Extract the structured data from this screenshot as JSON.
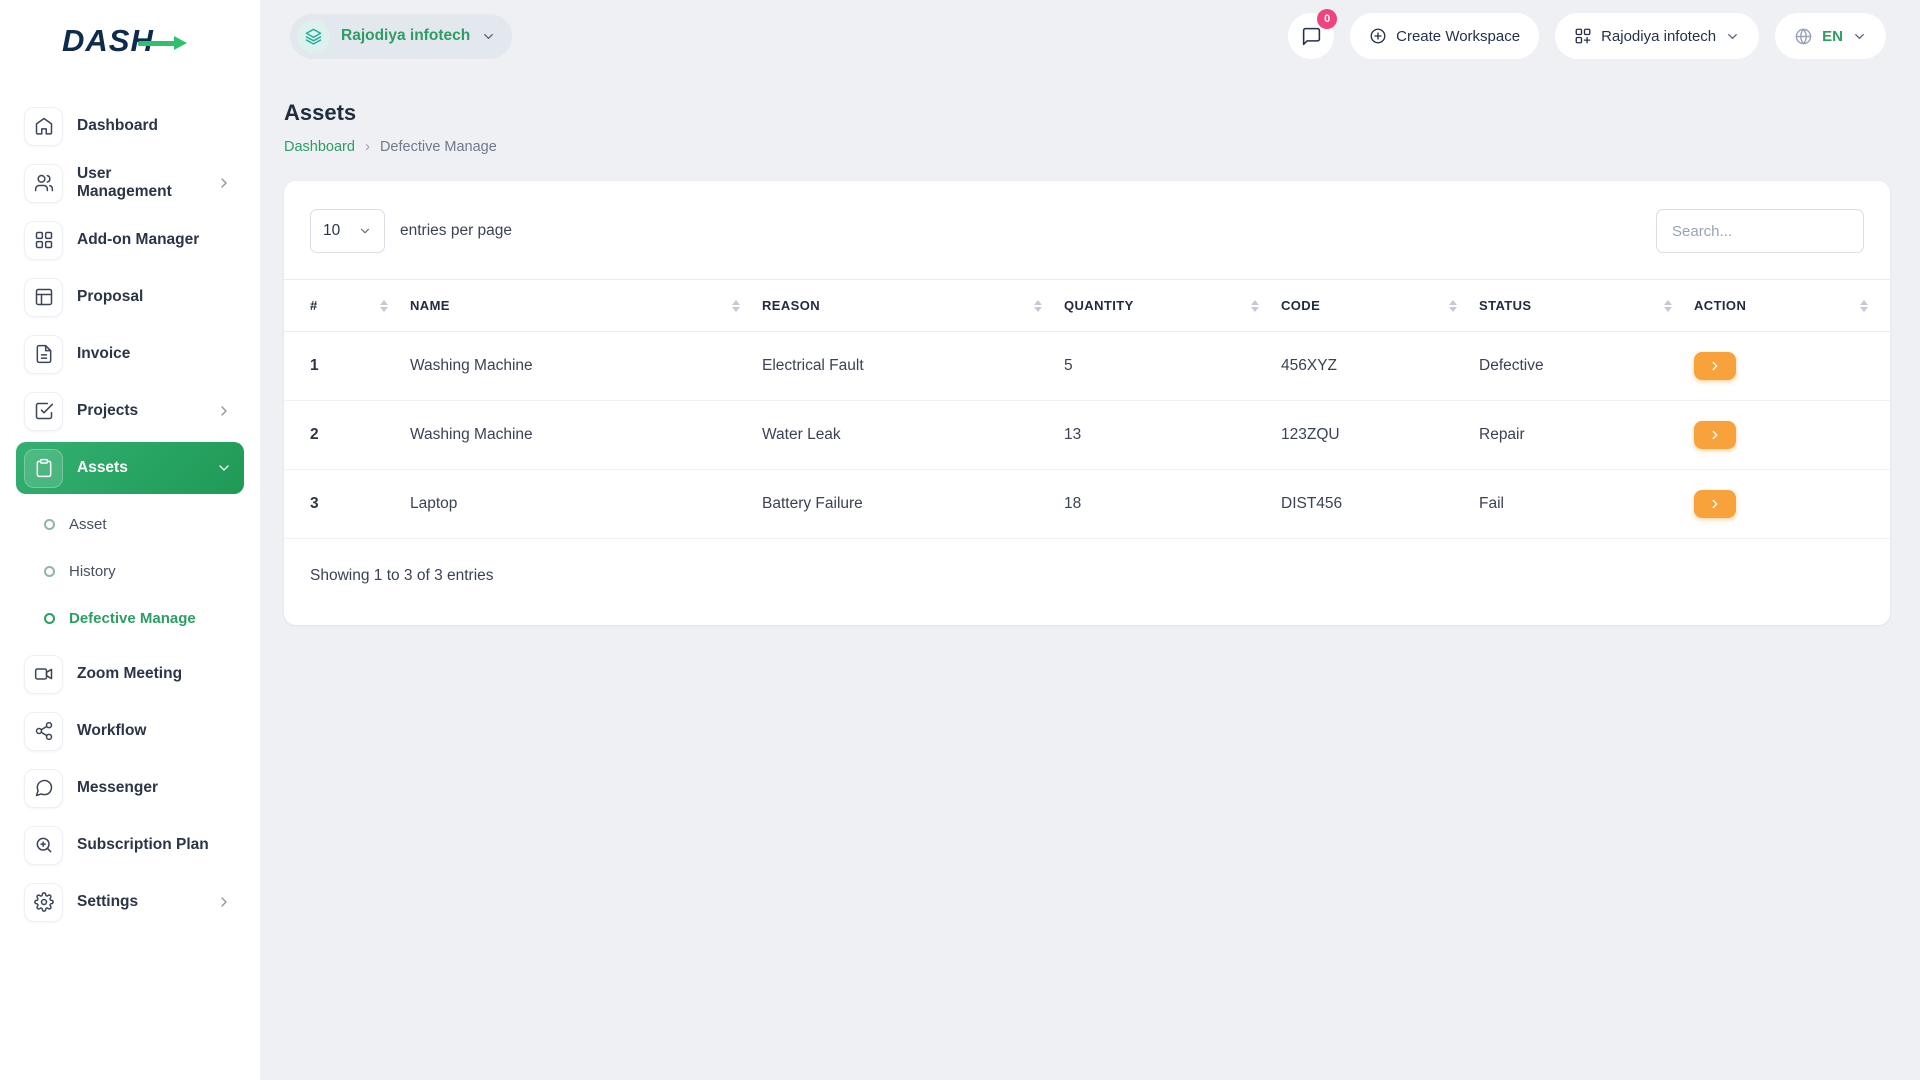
{
  "app": {
    "logo_text": "DASH"
  },
  "topbar": {
    "workspace_pill_label": "Rajodiya infotech",
    "notification_count": "0",
    "create_workspace_label": "Create Workspace",
    "workspace_dropdown_label": "Rajodiya infotech",
    "language_label": "EN"
  },
  "sidebar": {
    "items": [
      {
        "label": "Dashboard"
      },
      {
        "label": "User Management"
      },
      {
        "label": "Add-on Manager"
      },
      {
        "label": "Proposal"
      },
      {
        "label": "Invoice"
      },
      {
        "label": "Projects"
      },
      {
        "label": "Assets"
      },
      {
        "label": "Zoom Meeting"
      },
      {
        "label": "Workflow"
      },
      {
        "label": "Messenger"
      },
      {
        "label": "Subscription Plan"
      },
      {
        "label": "Settings"
      }
    ],
    "assets_submenu": [
      {
        "label": "Asset"
      },
      {
        "label": "History"
      },
      {
        "label": "Defective Manage"
      }
    ]
  },
  "page": {
    "title": "Assets",
    "breadcrumb_root": "Dashboard",
    "breadcrumb_current": "Defective Manage"
  },
  "table_card": {
    "entries_value": "10",
    "entries_label": "entries per page",
    "search_placeholder": "Search...",
    "columns": [
      "#",
      "NAME",
      "REASON",
      "QUANTITY",
      "CODE",
      "STATUS",
      "ACTION"
    ],
    "rows": [
      {
        "num": "1",
        "name": "Washing Machine",
        "reason": "Electrical Fault",
        "quantity": "5",
        "code": "456XYZ",
        "status": "Defective"
      },
      {
        "num": "2",
        "name": "Washing Machine",
        "reason": "Water Leak",
        "quantity": "13",
        "code": "123ZQU",
        "status": "Repair"
      },
      {
        "num": "3",
        "name": "Laptop",
        "reason": "Battery Failure",
        "quantity": "18",
        "code": "DIST456",
        "status": "Fail"
      }
    ],
    "footer_text": "Showing 1 to 3 of 3 entries"
  },
  "colors": {
    "accent_green": "#2d9d64",
    "action_orange": "#f8a23c",
    "badge_pink": "#f1437e"
  }
}
